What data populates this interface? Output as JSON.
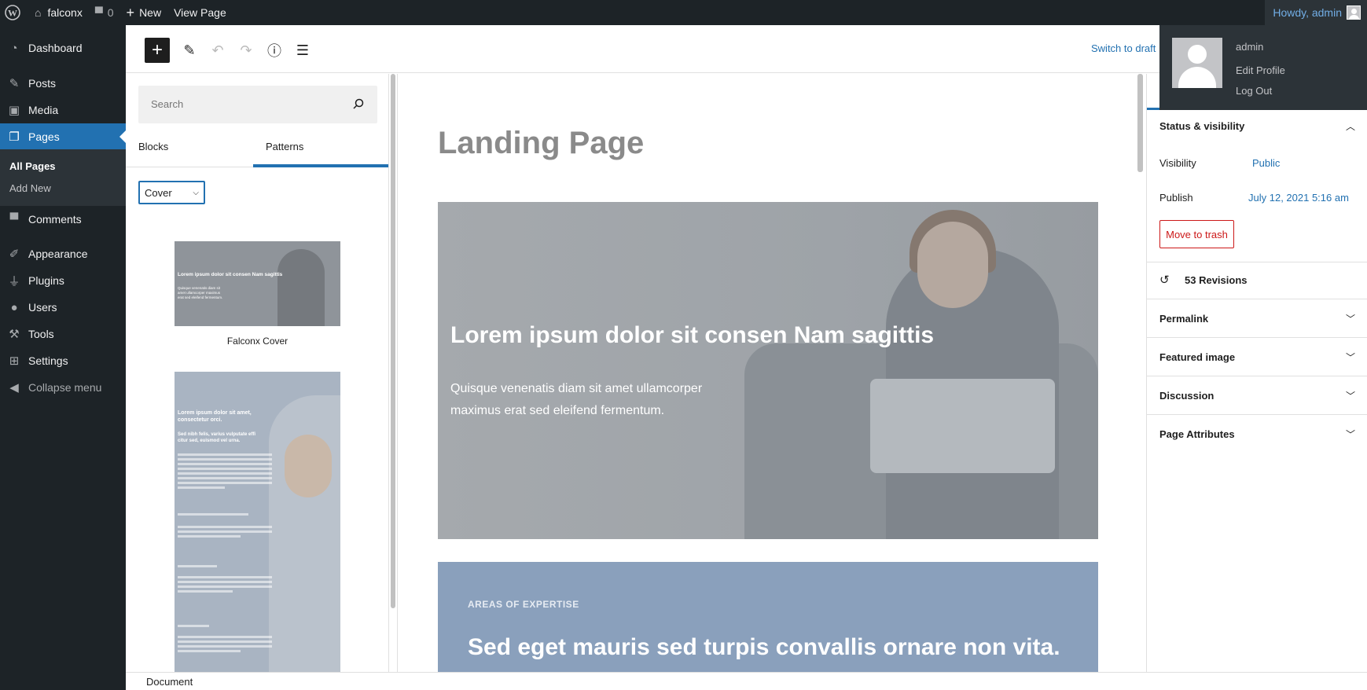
{
  "adminbar": {
    "site": "falconx",
    "comments": "0",
    "new": "New",
    "view_page": "View Page",
    "howdy": "Howdy, admin"
  },
  "user_menu": {
    "name": "admin",
    "edit_profile": "Edit Profile",
    "log_out": "Log Out"
  },
  "sidebar": {
    "items": [
      {
        "label": "Dashboard",
        "icon": "dashboard-icon"
      },
      {
        "label": "Posts",
        "icon": "pin-icon"
      },
      {
        "label": "Media",
        "icon": "media-icon"
      },
      {
        "label": "Pages",
        "icon": "pages-icon"
      },
      {
        "label": "Comments",
        "icon": "comment-icon"
      },
      {
        "label": "Appearance",
        "icon": "brush-icon"
      },
      {
        "label": "Plugins",
        "icon": "plugin-icon"
      },
      {
        "label": "Users",
        "icon": "user-icon"
      },
      {
        "label": "Tools",
        "icon": "wrench-icon"
      },
      {
        "label": "Settings",
        "icon": "settings-icon"
      },
      {
        "label": "Collapse menu",
        "icon": "collapse-icon"
      }
    ],
    "submenu": [
      "All Pages",
      "Add New"
    ]
  },
  "toolbar": {
    "switch_draft": "Switch to draft"
  },
  "inserter": {
    "search_placeholder": "Search",
    "tabs": [
      "Blocks",
      "Patterns"
    ],
    "category": "Cover",
    "patterns": [
      {
        "label": "Falconx Cover",
        "heading": "Lorem ipsum dolor sit consen Nam sagittis",
        "text": "Quisque venenatis diam sit amet ullamcorper maximus erat sed eleifend fermentum."
      },
      {
        "heading": "Lorem ipsum dolor sit amet, consectetur orci.",
        "sub": "Sed nibh felis, varius vulputate effi citur sed, euismod vel urna."
      }
    ]
  },
  "canvas": {
    "title": "Landing Page",
    "cover_heading": "Lorem ipsum dolor sit consen Nam sagittis",
    "cover_text": "Quisque venenatis diam sit amet ullamcorper maximus erat sed eleifend fermentum.",
    "kicker": "AREAS OF EXPERTISE",
    "section_heading": "Sed eget mauris sed turpis convallis ornare non vita."
  },
  "settings": {
    "status": "Status & visibility",
    "visibility_label": "Visibility",
    "visibility_value": "Public",
    "publish_label": "Publish",
    "publish_value": "July 12, 2021 5:16 am",
    "trash": "Move to trash",
    "revisions": "53 Revisions",
    "panels": [
      "Permalink",
      "Featured image",
      "Discussion",
      "Page Attributes"
    ]
  },
  "footer": {
    "breadcrumb": "Document"
  }
}
